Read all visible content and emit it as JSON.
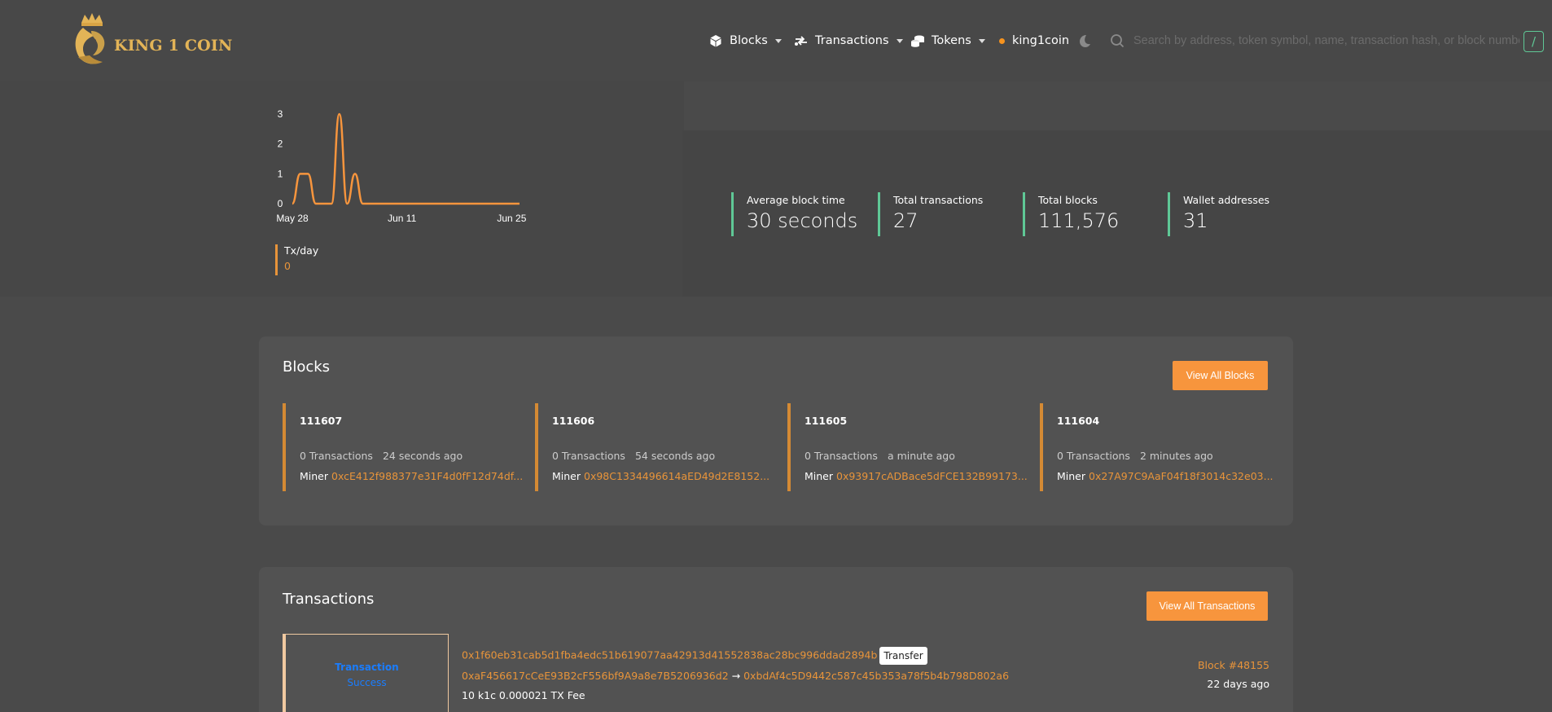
{
  "header": {
    "logo_text": "KING 1 COIN",
    "nav": {
      "blocks_label": "Blocks",
      "transactions_label": "Transactions",
      "tokens_label": "Tokens",
      "network_label": "king1coin"
    },
    "search_placeholder": "Search by address, token symbol, name, transaction hash, or block number",
    "search_shortcut": "/"
  },
  "chart_data": {
    "type": "line",
    "x": [
      "May 28",
      "May 29",
      "May 30",
      "May 31",
      "Jun 1",
      "Jun 2",
      "Jun 3",
      "Jun 4",
      "Jun 5",
      "Jun 6",
      "Jun 7",
      "Jun 8",
      "Jun 9",
      "Jun 10",
      "Jun 11",
      "Jun 12",
      "Jun 13",
      "Jun 14",
      "Jun 15",
      "Jun 16",
      "Jun 17",
      "Jun 18",
      "Jun 19",
      "Jun 20",
      "Jun 21",
      "Jun 22",
      "Jun 23",
      "Jun 24",
      "Jun 25",
      "Jun 26"
    ],
    "series": [
      {
        "name": "Tx/day",
        "values": [
          0,
          1,
          1,
          0,
          0,
          0,
          3,
          0,
          1,
          0,
          0,
          0,
          0,
          0,
          0,
          0,
          0,
          0,
          0,
          0,
          0,
          0,
          0,
          0,
          0,
          0,
          0,
          0,
          0,
          0
        ]
      }
    ],
    "y_ticks": [
      "0",
      "1",
      "2",
      "3"
    ],
    "x_ticks": [
      "May 28",
      "Jun 11",
      "Jun 25"
    ],
    "ylim": [
      0,
      3
    ],
    "color": "#f7953d",
    "grid": false
  },
  "legend": {
    "label": "Tx/day",
    "value": "0"
  },
  "stats": [
    {
      "label": "Average block time",
      "value": "30 seconds"
    },
    {
      "label": "Total transactions",
      "value": "27"
    },
    {
      "label": "Total blocks",
      "value": "111,576"
    },
    {
      "label": "Wallet addresses",
      "value": "31"
    }
  ],
  "blocks_section": {
    "title": "Blocks",
    "view_all_label": "View All Blocks",
    "blocks": [
      {
        "number": "111607",
        "tx_count": "0 Transactions",
        "age": "24 seconds ago",
        "miner_label": "Miner",
        "miner": "0xcE412f988377e31F4d0fF12d74df..."
      },
      {
        "number": "111606",
        "tx_count": "0 Transactions",
        "age": "54 seconds ago",
        "miner_label": "Miner",
        "miner": "0x98C1334496614aED49d2E8152..."
      },
      {
        "number": "111605",
        "tx_count": "0 Transactions",
        "age": "a minute ago",
        "miner_label": "Miner",
        "miner": "0x93917cADBace5dFCE132B99173..."
      },
      {
        "number": "111604",
        "tx_count": "0 Transactions",
        "age": "2 minutes ago",
        "miner_label": "Miner",
        "miner": "0x27A97C9AaF04f18f3014c32e03..."
      }
    ]
  },
  "transactions_section": {
    "title": "Transactions",
    "view_all_label": "View All Transactions",
    "items": [
      {
        "status_type": "Transaction",
        "status_result": "Success",
        "hash": "0x1f60eb31cab5d1fba4edc51b619077aa42913d41552838ac28bc996ddad2894b",
        "tag": "Transfer",
        "from": "0xaF456617cCeE93B2cF556bf9A9a8e7B5206936d2",
        "arrow": "→",
        "to": "0xbdAf4c5D9442c587c45b353a78f5b4b798D802a6",
        "amount": "10 k1c 0.000021 TX Fee",
        "block": "Block #48155",
        "age": "22 days ago"
      }
    ]
  },
  "colors": {
    "accent": "#f7953d",
    "link": "#e8943a",
    "stat_border": "#5fc896",
    "status_blue": "#1a7dff"
  }
}
